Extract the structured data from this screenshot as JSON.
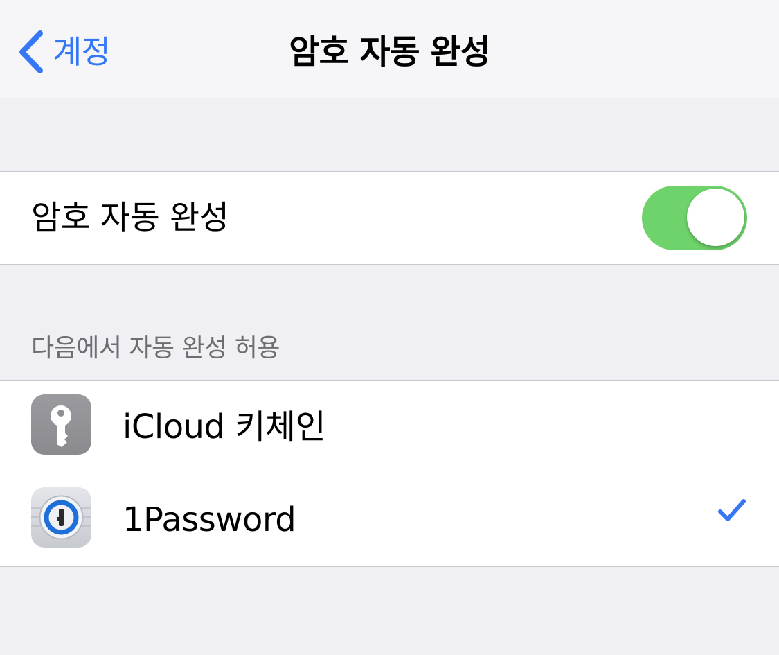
{
  "navbar": {
    "back_label": "계정",
    "title": "암호 자동 완성"
  },
  "autofill_toggle": {
    "label": "암호 자동 완성",
    "enabled": true
  },
  "allow_section": {
    "header": "다음에서 자동 완성 허용",
    "items": [
      {
        "label": "iCloud 키체인",
        "icon": "key-icon",
        "selected": false
      },
      {
        "label": "1Password",
        "icon": "1password-icon",
        "selected": true
      }
    ]
  },
  "colors": {
    "accent": "#3478f6",
    "toggle_on": "#6fd36b",
    "background": "#efeff4",
    "navbar_bg": "#f6f6f8",
    "section_header": "#6d6d72"
  }
}
